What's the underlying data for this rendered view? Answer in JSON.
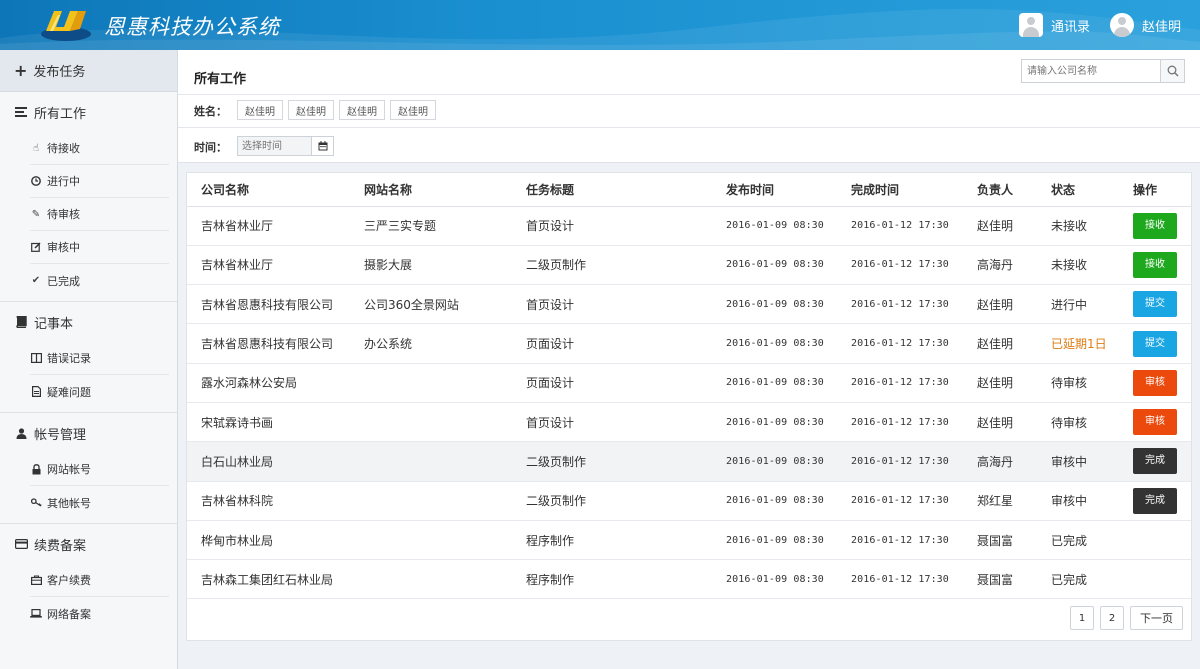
{
  "header": {
    "title": "恩惠科技办公系统",
    "contacts_label": "通讯录",
    "user_name": "赵佳明"
  },
  "sidebar": {
    "publish_label": "发布任务",
    "groups": [
      {
        "label": "所有工作",
        "icon": "list-icon",
        "items": [
          {
            "label": "待接收",
            "icon": "hand-pointer-icon"
          },
          {
            "label": "进行中",
            "icon": "clock-icon"
          },
          {
            "label": "待审核",
            "icon": "pencil-icon"
          },
          {
            "label": "审核中",
            "icon": "edit-icon"
          },
          {
            "label": "已完成",
            "icon": "check-icon"
          }
        ]
      },
      {
        "label": "记事本",
        "icon": "book-icon",
        "items": [
          {
            "label": "错误记录",
            "icon": "columns-icon"
          },
          {
            "label": "疑难问题",
            "icon": "file-icon"
          }
        ]
      },
      {
        "label": "帐号管理",
        "icon": "user-icon",
        "items": [
          {
            "label": "网站帐号",
            "icon": "lock-icon"
          },
          {
            "label": "其他帐号",
            "icon": "key-icon"
          }
        ]
      },
      {
        "label": "续费备案",
        "icon": "credit-card-icon",
        "items": [
          {
            "label": "客户续费",
            "icon": "briefcase-icon"
          },
          {
            "label": "网络备案",
            "icon": "laptop-icon"
          }
        ]
      }
    ]
  },
  "main": {
    "title": "所有工作",
    "search_placeholder": "请输入公司名称",
    "filters": {
      "name_label": "姓名：",
      "names": [
        "赵佳明",
        "赵佳明",
        "赵佳明",
        "赵佳明"
      ],
      "time_label": "时间：",
      "time_placeholder": "选择时间"
    },
    "table": {
      "headers": [
        "公司名称",
        "网站名称",
        "任务标题",
        "发布时间",
        "完成时间",
        "负责人",
        "状态",
        "操作"
      ],
      "rows": [
        {
          "company": "吉林省林业厅",
          "site": "三严三实专题",
          "task": "首页设计",
          "publish": "2016-01-09 08:30",
          "finish": "2016-01-12 17:30",
          "owner": "赵佳明",
          "status": "未接收",
          "action": "接收",
          "action_color": "#1ea81e"
        },
        {
          "company": "吉林省林业厅",
          "site": "摄影大展",
          "task": "二级页制作",
          "publish": "2016-01-09 08:30",
          "finish": "2016-01-12 17:30",
          "owner": "高海丹",
          "status": "未接收",
          "action": "接收",
          "action_color": "#1ea81e"
        },
        {
          "company": "吉林省恩惠科技有限公司",
          "site": "公司360全景网站",
          "task": "首页设计",
          "publish": "2016-01-09 08:30",
          "finish": "2016-01-12 17:30",
          "owner": "赵佳明",
          "status": "进行中",
          "action": "提交",
          "action_color": "#19a6e3"
        },
        {
          "company": "吉林省恩惠科技有限公司",
          "site": "办公系统",
          "task": "页面设计",
          "publish": "2016-01-09 08:30",
          "finish": "2016-01-12 17:30",
          "owner": "赵佳明",
          "status": "已延期1日",
          "status_late": true,
          "action": "提交",
          "action_color": "#19a6e3"
        },
        {
          "company": "露水河森林公安局",
          "site": "",
          "task": "页面设计",
          "publish": "2016-01-09 08:30",
          "finish": "2016-01-12 17:30",
          "owner": "赵佳明",
          "status": "待审核",
          "action": "审核",
          "action_color": "#ec4a0d"
        },
        {
          "company": "宋轼霖诗书画",
          "site": "",
          "task": "首页设计",
          "publish": "2016-01-09 08:30",
          "finish": "2016-01-12 17:30",
          "owner": "赵佳明",
          "status": "待审核",
          "action": "审核",
          "action_color": "#ec4a0d"
        },
        {
          "company": "白石山林业局",
          "site": "",
          "task": "二级页制作",
          "publish": "2016-01-09 08:30",
          "finish": "2016-01-12 17:30",
          "owner": "高海丹",
          "status": "审核中",
          "action": "完成",
          "action_color": "#333333",
          "highlight": true
        },
        {
          "company": "吉林省林科院",
          "site": "",
          "task": "二级页制作",
          "publish": "2016-01-09 08:30",
          "finish": "2016-01-12 17:30",
          "owner": "郑红星",
          "status": "审核中",
          "action": "完成",
          "action_color": "#333333"
        },
        {
          "company": "桦甸市林业局",
          "site": "",
          "task": "程序制作",
          "publish": "2016-01-09 08:30",
          "finish": "2016-01-12 17:30",
          "owner": "聂国富",
          "status": "已完成",
          "action": ""
        },
        {
          "company": "吉林森工集团红石林业局",
          "site": "",
          "task": "程序制作",
          "publish": "2016-01-09 08:30",
          "finish": "2016-01-12 17:30",
          "owner": "聂国富",
          "status": "已完成",
          "action": ""
        }
      ]
    },
    "pagination": {
      "pages": [
        "1",
        "2"
      ],
      "next_label": "下一页"
    }
  }
}
